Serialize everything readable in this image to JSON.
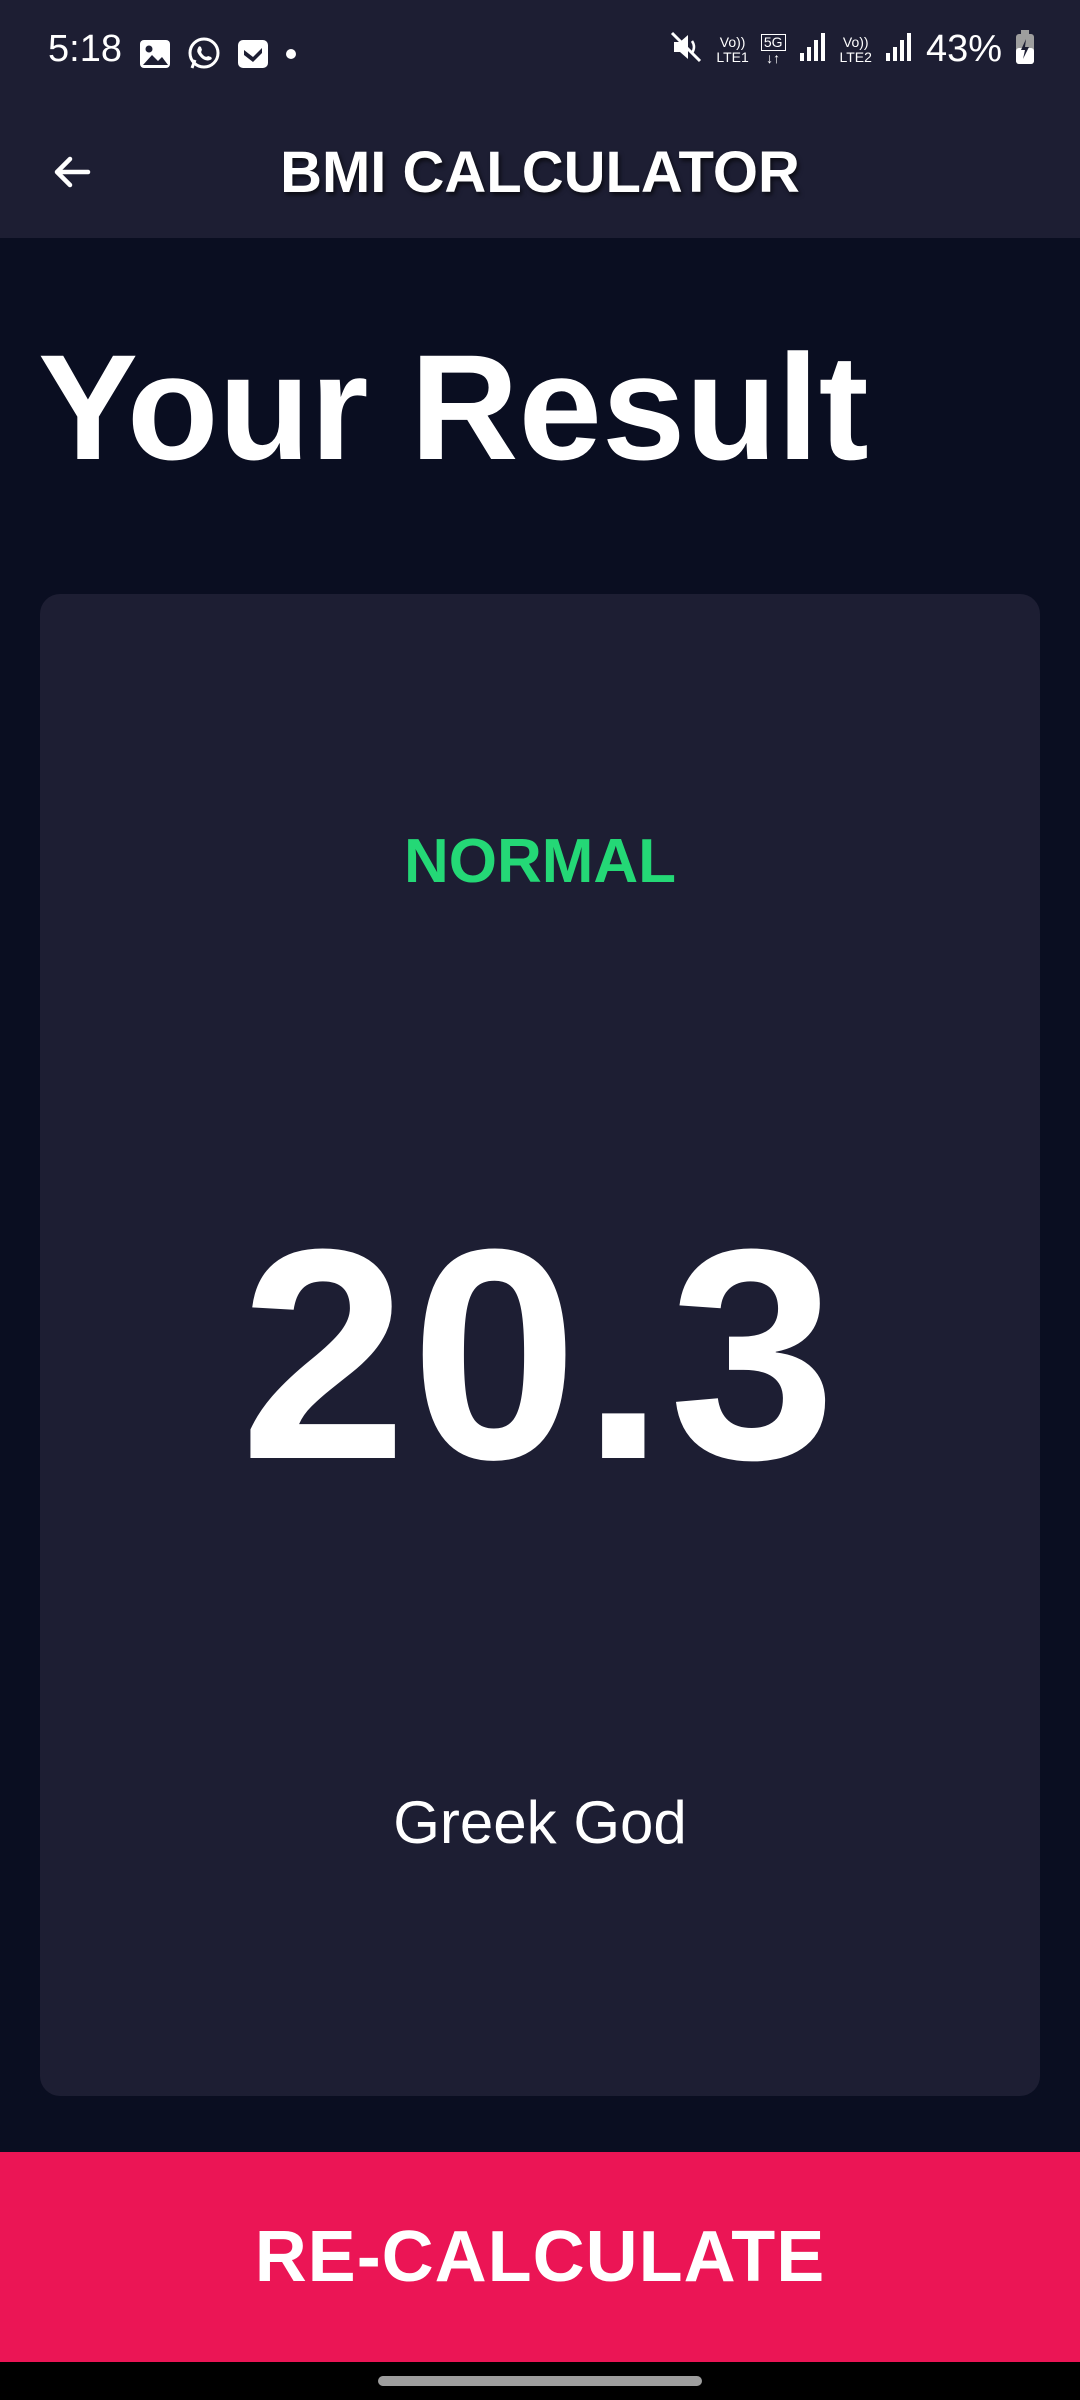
{
  "status_bar": {
    "time": "5:18",
    "battery_percent": "43%",
    "sim1_label_top": "Vo))",
    "sim1_label_bottom": "LTE1",
    "network_label": "5G",
    "sim2_label_top": "Vo))",
    "sim2_label_bottom": "LTE2",
    "left_icons": [
      "gallery-icon",
      "whatsapp-icon",
      "app-icon",
      "dot-icon"
    ],
    "right_icons": [
      "mute-icon",
      "signal-icon",
      "signal-icon",
      "battery-icon"
    ]
  },
  "app_bar": {
    "title": "BMI CALCULATOR",
    "back_icon": "arrow-back-icon"
  },
  "main": {
    "heading": "Your Result",
    "result": {
      "status": "NORMAL",
      "bmi": "20.3",
      "interpretation": "Greek God"
    }
  },
  "actions": {
    "recalculate_label": "RE-CALCULATE"
  },
  "colors": {
    "background": "#0a0e21",
    "card": "#1d1e33",
    "status_green": "#24d876",
    "accent_pink": "#eb1555"
  }
}
